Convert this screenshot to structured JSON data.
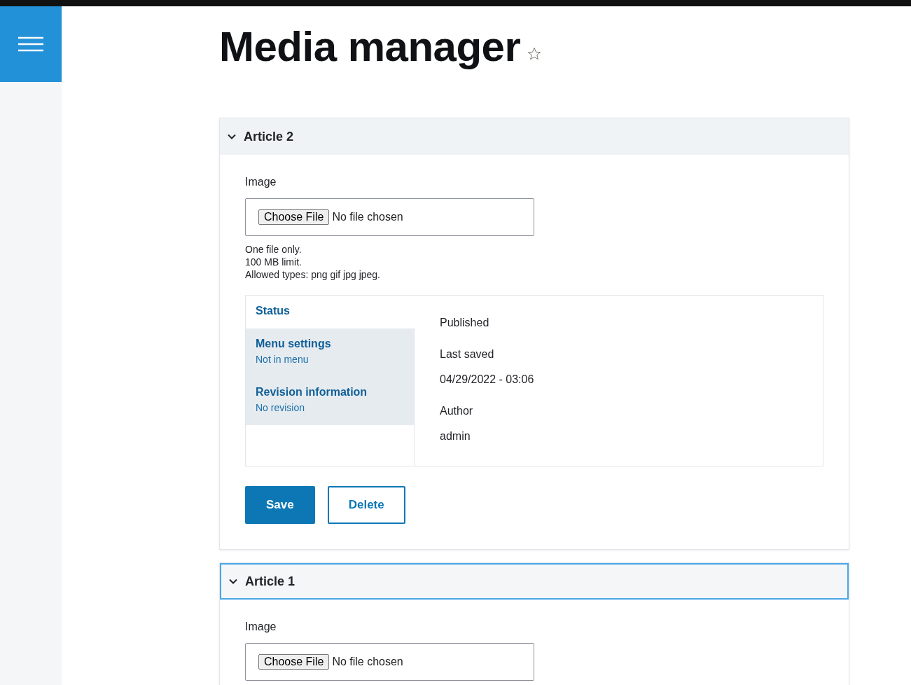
{
  "page_title": "Media manager",
  "favorite": {
    "starred": false
  },
  "panels": [
    {
      "title": "Article 2",
      "expanded": true,
      "focused": false,
      "image_label": "Image",
      "file_button": "Choose File",
      "file_status": "No file chosen",
      "help": [
        "One file only.",
        "100 MB limit.",
        "Allowed types: png gif jpg jpeg."
      ],
      "vertical_tabs": [
        {
          "title": "Status",
          "selected": true
        },
        {
          "title": "Menu settings",
          "summary": "Not in menu",
          "selected": false
        },
        {
          "title": "Revision information",
          "summary": "No revision",
          "selected": false
        }
      ],
      "tab_content": [
        {
          "kind": "label",
          "text": "Published"
        },
        {
          "kind": "label",
          "text": "Last saved"
        },
        {
          "kind": "value",
          "text": "04/29/2022 - 03:06"
        },
        {
          "kind": "label",
          "text": "Author"
        },
        {
          "kind": "value",
          "text": "admin"
        }
      ],
      "buttons": [
        {
          "label": "Save",
          "kind": "primary"
        },
        {
          "label": "Delete",
          "kind": "secondary"
        }
      ]
    },
    {
      "title": "Article 1",
      "expanded": true,
      "focused": true,
      "image_label": "Image",
      "file_button": "Choose File",
      "file_status": "No file chosen"
    }
  ]
}
